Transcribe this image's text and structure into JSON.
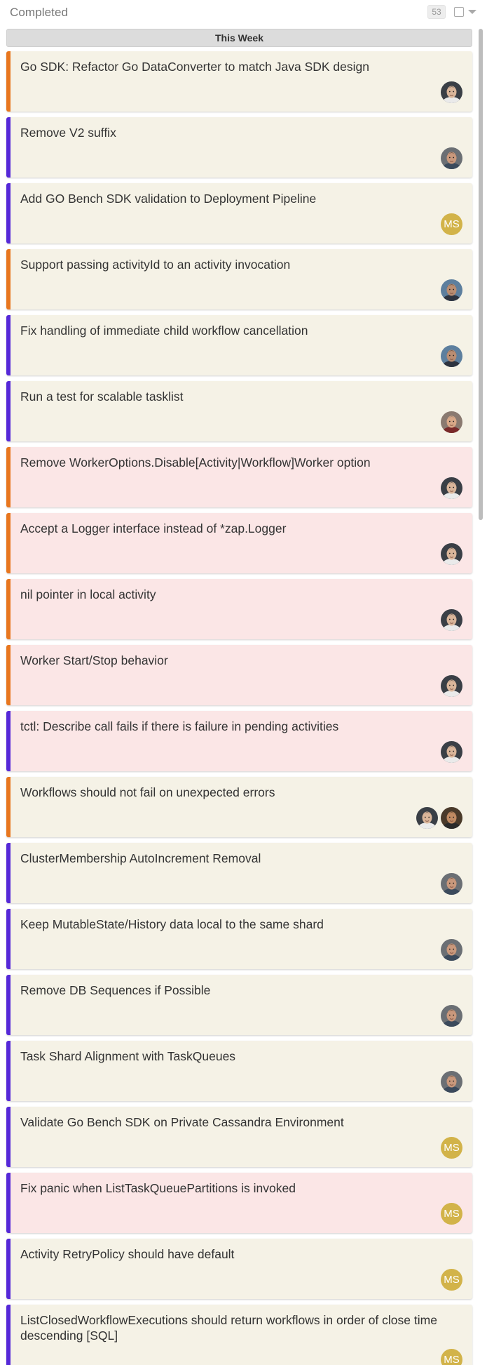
{
  "column": {
    "title": "Completed",
    "count": "53"
  },
  "group": {
    "title": "This Week"
  },
  "cards": [
    {
      "title": "Go SDK: Refactor Go DataConverter to match Java SDK design",
      "status_color": "orange",
      "background": "beige",
      "assignees": [
        "face-a"
      ]
    },
    {
      "title": "Remove V2 suffix",
      "status_color": "purple",
      "background": "beige",
      "assignees": [
        "face-b"
      ]
    },
    {
      "title": "Add GO Bench SDK validation to Deployment Pipeline",
      "status_color": "purple",
      "background": "beige",
      "assignees": [
        "MS"
      ]
    },
    {
      "title": "Support passing activityId to an activity invocation",
      "status_color": "orange",
      "background": "beige",
      "assignees": [
        "face-c"
      ]
    },
    {
      "title": "Fix handling of immediate child workflow cancellation",
      "status_color": "purple",
      "background": "beige",
      "assignees": [
        "face-c"
      ]
    },
    {
      "title": "Run a test for scalable tasklist",
      "status_color": "purple",
      "background": "beige",
      "assignees": [
        "face-d"
      ]
    },
    {
      "title": "Remove WorkerOptions.Disable[Activity|Workflow]Worker option",
      "status_color": "orange",
      "background": "pink",
      "assignees": [
        "face-a"
      ]
    },
    {
      "title": "Accept a Logger interface instead of *zap.Logger",
      "status_color": "orange",
      "background": "pink",
      "assignees": [
        "face-a"
      ]
    },
    {
      "title": "nil pointer in local activity",
      "status_color": "orange",
      "background": "pink",
      "assignees": [
        "face-a"
      ]
    },
    {
      "title": "Worker Start/Stop behavior",
      "status_color": "orange",
      "background": "pink",
      "assignees": [
        "face-a"
      ]
    },
    {
      "title": "tctl: Describe call fails if there is failure in pending activities",
      "status_color": "purple",
      "background": "pink",
      "assignees": [
        "face-a"
      ]
    },
    {
      "title": "Workflows should not fail on unexpected errors",
      "status_color": "orange",
      "background": "beige",
      "assignees": [
        "face-a",
        "face-e"
      ]
    },
    {
      "title": "ClusterMembership AutoIncrement Removal",
      "status_color": "purple",
      "background": "beige",
      "assignees": [
        "face-b"
      ]
    },
    {
      "title": "Keep MutableState/History data local to the same shard",
      "status_color": "purple",
      "background": "beige",
      "assignees": [
        "face-b"
      ]
    },
    {
      "title": "Remove DB Sequences if Possible",
      "status_color": "purple",
      "background": "beige",
      "assignees": [
        "face-b"
      ]
    },
    {
      "title": "Task Shard Alignment with TaskQueues",
      "status_color": "purple",
      "background": "beige",
      "assignees": [
        "face-b"
      ]
    },
    {
      "title": "Validate Go Bench SDK on Private Cassandra Environment",
      "status_color": "purple",
      "background": "beige",
      "assignees": [
        "MS"
      ]
    },
    {
      "title": "Fix panic when ListTaskQueuePartitions is invoked",
      "status_color": "purple",
      "background": "pink",
      "assignees": [
        "MS"
      ]
    },
    {
      "title": "Activity RetryPolicy should have default",
      "status_color": "purple",
      "background": "beige",
      "assignees": [
        "MS"
      ]
    },
    {
      "title": "ListClosedWorkflowExecutions should return workflows in order of close time descending [SQL]",
      "status_color": "purple",
      "background": "beige",
      "assignees": [
        "MS"
      ]
    }
  ],
  "colors": {
    "orange": "#e8761e",
    "purple": "#5528d8",
    "beige": "#f5f2e6",
    "pink": "#fbe6e6",
    "initials_avatar": "#d2b349"
  }
}
